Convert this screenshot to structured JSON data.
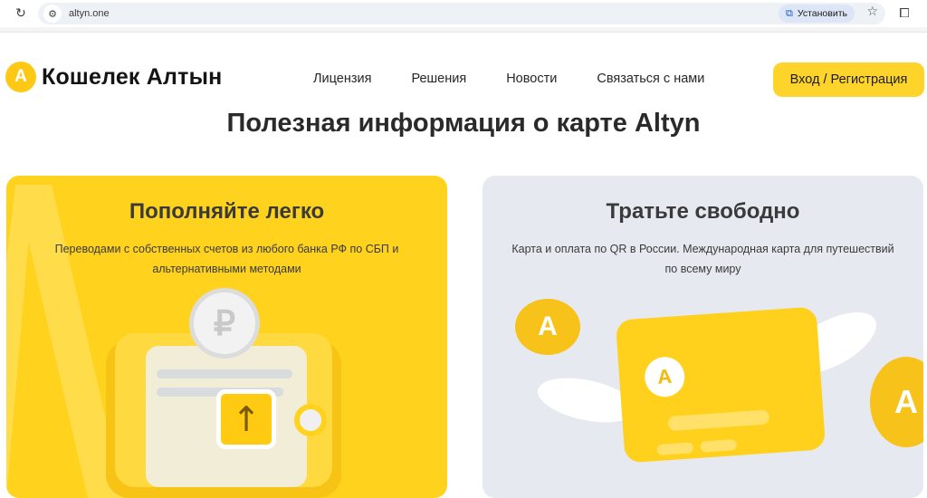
{
  "browser": {
    "url": "altyn.one",
    "install_label": "Установить"
  },
  "header": {
    "logo_letter": "A",
    "logo_text": "Кошелек Алтын",
    "nav": [
      "Лицензия",
      "Решения",
      "Новости",
      "Связаться с нами"
    ],
    "login_label": "Вход / Регистрация"
  },
  "section": {
    "title": "Полезная информация о карте Altyn"
  },
  "cards": [
    {
      "title": "Пополняйте легко",
      "description": "Переводами с собственных счетов из любого банка РФ по СБП и альтернативными методами",
      "coin_symbol": "₽",
      "arrow_symbol": "↑"
    },
    {
      "title": "Тратьте свободно",
      "description": "Карта и оплата по QR в России. Международная карта для путешествий по всему миру",
      "coin_letter": "A"
    }
  ],
  "colors": {
    "brand_yellow": "#ffd21e",
    "button_yellow": "#ffd42a",
    "card_gray": "#e6e9ef"
  },
  "icons": [
    "reload-icon",
    "site-settings-icon",
    "install-app-icon",
    "bookmark-star-icon",
    "extensions-icon"
  ]
}
